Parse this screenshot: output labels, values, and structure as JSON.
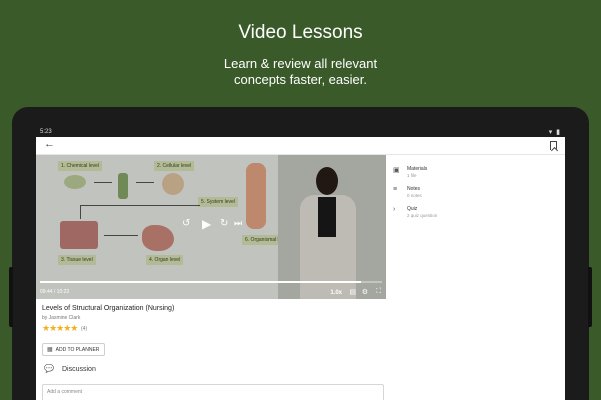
{
  "promo": {
    "title": "Video Lessons",
    "subtitle_line1": "Learn & review all relevant",
    "subtitle_line2": "concepts faster, easier."
  },
  "status_bar": {
    "time": "5:23",
    "icons": "▾ ▮"
  },
  "app_bar": {
    "back_icon": "←"
  },
  "video": {
    "diagram_labels": {
      "chemical": "1. Chemical level",
      "cellular": "2. Cellular level",
      "tissue": "3. Tissue level",
      "organ": "4. Organ level",
      "system": "5. System level",
      "organismal": "6. Organismal level"
    },
    "controls": {
      "rewind": "↺",
      "play": "▶",
      "forward": "↻",
      "next": "⏭"
    },
    "progress": 0.94,
    "time_readout": "09:44 / 10:23",
    "speed": "1.0x",
    "subtitles_icon": "▤",
    "settings_icon": "⚙",
    "fullscreen_icon": "⛶"
  },
  "lesson": {
    "title": "Levels of Structural Organization (Nursing)",
    "author": "by Jasmine Clark",
    "stars": "★★★★★",
    "rating_count": "(4)",
    "add_planner_label": "ADD TO PLANNER",
    "planner_icon": "▦",
    "discussion_icon": "💬",
    "discussion_label": "Discussion",
    "comment_placeholder": "Add a comment"
  },
  "side_panel": {
    "items": [
      {
        "icon": "▣",
        "title": "Materials",
        "sub": "1 file"
      },
      {
        "icon": "≡",
        "title": "Notes",
        "sub": "0 notes"
      },
      {
        "icon": "›",
        "title": "Quiz",
        "sub": "2 quiz question"
      }
    ]
  },
  "colors": {
    "background": "#3a5a2a",
    "star": "#f2b01e",
    "diagram_label": "#dbe4b8"
  }
}
